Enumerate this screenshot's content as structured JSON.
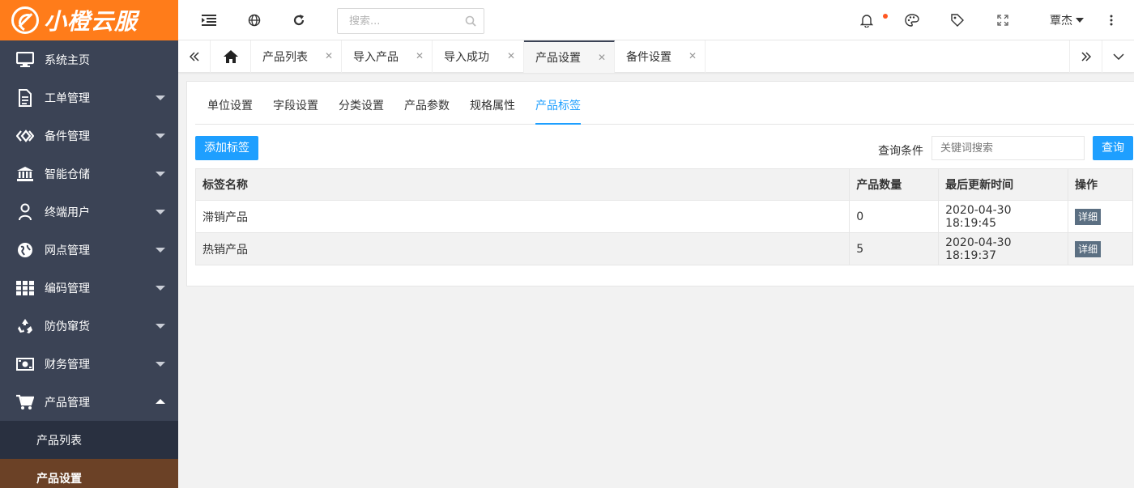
{
  "brand": {
    "name": "小橙云服"
  },
  "sidebar": {
    "items": [
      {
        "label": "系统主页",
        "icon": "monitor-icon",
        "has_caret": false
      },
      {
        "label": "工单管理",
        "icon": "document-icon",
        "has_caret": true
      },
      {
        "label": "备件管理",
        "icon": "diamond-link-icon",
        "has_caret": true
      },
      {
        "label": "智能仓储",
        "icon": "bank-icon",
        "has_caret": true
      },
      {
        "label": "终端用户",
        "icon": "user-icon",
        "has_caret": true
      },
      {
        "label": "网点管理",
        "icon": "globe-icon",
        "has_caret": true
      },
      {
        "label": "编码管理",
        "icon": "grid-icon",
        "has_caret": true
      },
      {
        "label": "防伪窜货",
        "icon": "recycle-icon",
        "has_caret": true
      },
      {
        "label": "财务管理",
        "icon": "money-icon",
        "has_caret": true
      },
      {
        "label": "产品管理",
        "icon": "cart-icon",
        "has_caret": true,
        "expanded": true
      }
    ],
    "sub_items": [
      {
        "label": "产品列表",
        "active": false
      },
      {
        "label": "产品设置",
        "active": true
      }
    ]
  },
  "topbar": {
    "search_placeholder": "搜索...",
    "user_name": "覃杰"
  },
  "tabs": [
    {
      "label": "产品列表",
      "active": false
    },
    {
      "label": "导入产品",
      "active": false
    },
    {
      "label": "导入成功",
      "active": false
    },
    {
      "label": "产品设置",
      "active": true
    },
    {
      "label": "备件设置",
      "active": false
    }
  ],
  "subtabs": [
    {
      "label": "单位设置",
      "active": false
    },
    {
      "label": "字段设置",
      "active": false
    },
    {
      "label": "分类设置",
      "active": false
    },
    {
      "label": "产品参数",
      "active": false
    },
    {
      "label": "规格属性",
      "active": false
    },
    {
      "label": "产品标签",
      "active": true
    }
  ],
  "toolbar": {
    "add_label": "添加标签",
    "filter_label": "查询条件",
    "filter_placeholder": "关键词搜索",
    "query_label": "查询"
  },
  "table": {
    "columns": [
      "标签名称",
      "产品数量",
      "最后更新时间",
      "操作"
    ],
    "rows": [
      {
        "name": "滞销产品",
        "count": "0",
        "updated": "2020-04-30 18:19:45",
        "action": "详细"
      },
      {
        "name": "热销产品",
        "count": "5",
        "updated": "2020-04-30 18:19:37",
        "action": "详细"
      }
    ]
  },
  "colors": {
    "brand_orange": "#ff7c1a",
    "sidebar_bg": "#3b4355",
    "primary_blue": "#1e9fff",
    "active_sub_bg": "#6b4126",
    "notify_dot": "#ff5722"
  }
}
